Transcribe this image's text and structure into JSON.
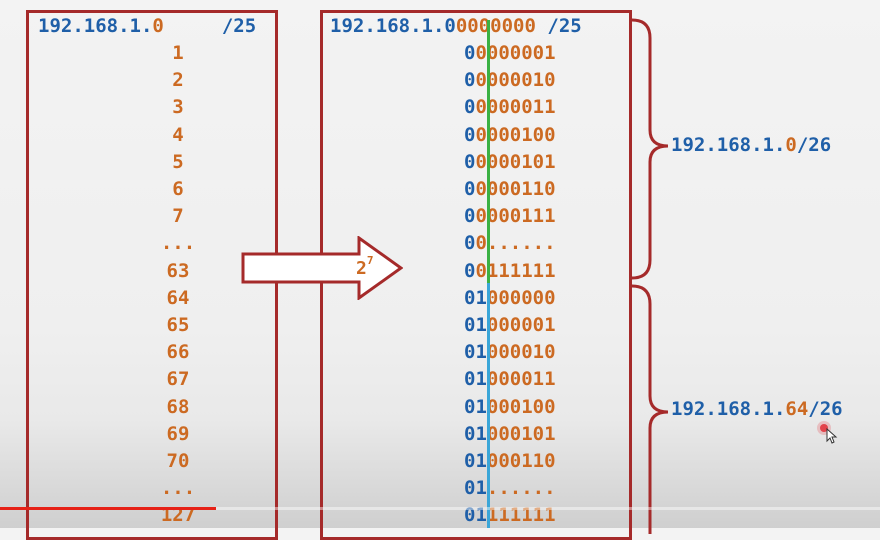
{
  "left": {
    "header_base": "192.168.1.",
    "header_host": "0",
    "header_prefix": "/25",
    "numbers": [
      "1",
      "2",
      "3",
      "4",
      "5",
      "6",
      "7",
      "...",
      "63",
      "64",
      "65",
      "66",
      "67",
      "68",
      "69",
      "70",
      "...",
      "127"
    ]
  },
  "right": {
    "header_base": "192.168.1.",
    "header_net": "0",
    "header_host": "0000000",
    "header_prefix": "/25",
    "rows": [
      {
        "net": "0",
        "split": "0",
        "host": "000001"
      },
      {
        "net": "0",
        "split": "0",
        "host": "000010"
      },
      {
        "net": "0",
        "split": "0",
        "host": "000011"
      },
      {
        "net": "0",
        "split": "0",
        "host": "000100"
      },
      {
        "net": "0",
        "split": "0",
        "host": "000101"
      },
      {
        "net": "0",
        "split": "0",
        "host": "000110"
      },
      {
        "net": "0",
        "split": "0",
        "host": "000111"
      },
      {
        "net": "0",
        "split": "0",
        "host": "......"
      },
      {
        "net": "0",
        "split": "0",
        "host": "111111"
      },
      {
        "net": "0",
        "split": "1",
        "host": "000000"
      },
      {
        "net": "0",
        "split": "1",
        "host": "000001"
      },
      {
        "net": "0",
        "split": "1",
        "host": "000010"
      },
      {
        "net": "0",
        "split": "1",
        "host": "000011"
      },
      {
        "net": "0",
        "split": "1",
        "host": "000100"
      },
      {
        "net": "0",
        "split": "1",
        "host": "000101"
      },
      {
        "net": "0",
        "split": "1",
        "host": "000110"
      },
      {
        "net": "0",
        "split": "1",
        "host": "......"
      },
      {
        "net": "0",
        "split": "1",
        "host": "111111"
      }
    ]
  },
  "arrow": {
    "base": "2",
    "exponent": "7"
  },
  "subnets": {
    "a": {
      "base": "192.168.1.",
      "host": "0",
      "prefix": "/26"
    },
    "b": {
      "base": "192.168.1.",
      "host": "64",
      "prefix": "/26"
    }
  },
  "player": {
    "progress": 0.245
  },
  "colors": {
    "network": "#1f5fa8",
    "host": "#cc6a22",
    "border": "#a52a2a",
    "split_top": "#3bb143",
    "split_bottom": "#3aa6d8",
    "progress": "#e62117"
  }
}
